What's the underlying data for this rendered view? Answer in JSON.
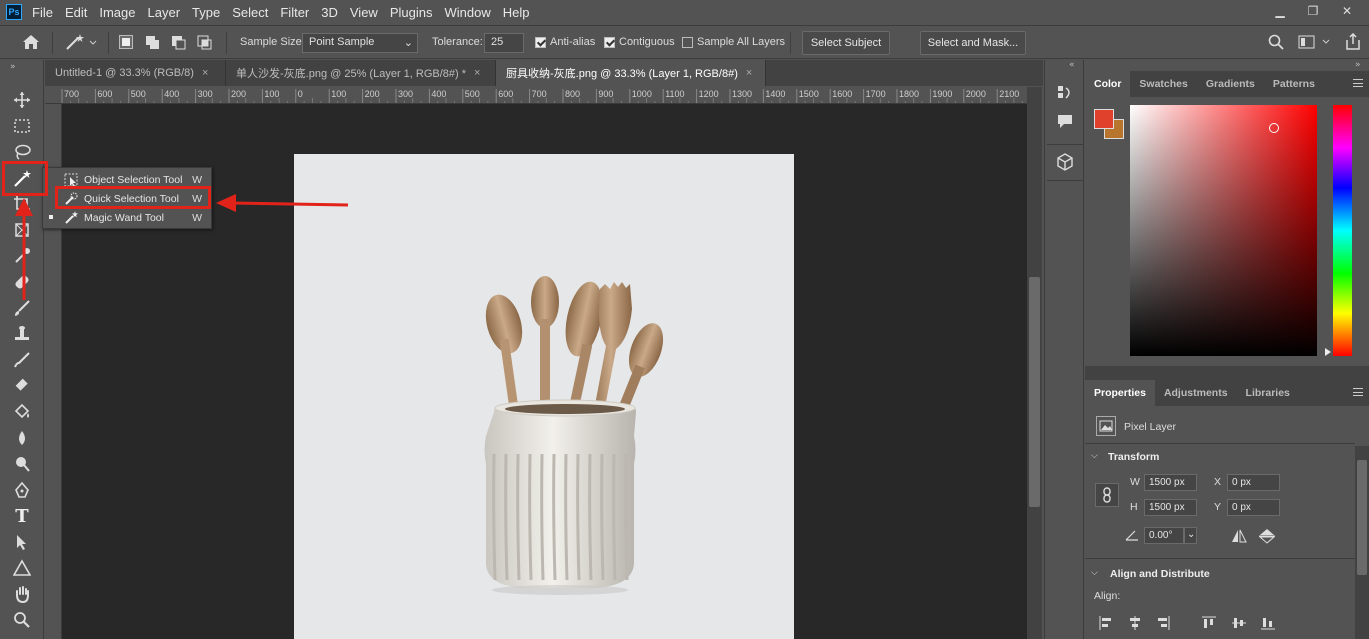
{
  "menubar": {
    "logo": "Ps",
    "items": [
      "File",
      "Edit",
      "Image",
      "Layer",
      "Type",
      "Select",
      "Filter",
      "3D",
      "View",
      "Plugins",
      "Window",
      "Help"
    ],
    "minimize": "▁",
    "restore": "❐",
    "close": "✕"
  },
  "options": {
    "sample_size_label": "Sample Size:",
    "sample_size_value": "Point Sample",
    "tolerance_label": "Tolerance:",
    "tolerance_value": "25",
    "anti_alias_label": "Anti-alias",
    "contiguous_label": "Contiguous",
    "sample_all_layers_label": "Sample All Layers",
    "select_subject_label": "Select Subject",
    "select_and_mask_label": "Select and Mask..."
  },
  "tabs": [
    {
      "label": "Untitled-1 @ 33.3% (RGB/8)",
      "close": "×"
    },
    {
      "label": "单人沙发-灰底.png @ 25% (Layer 1, RGB/8#) *",
      "close": "×"
    },
    {
      "label": "厨具收纳-灰底.png @ 33.3% (Layer 1, RGB/8#)",
      "close": "×"
    }
  ],
  "ruler": {
    "ticks": [
      "700",
      "600",
      "500",
      "400",
      "300",
      "200",
      "100",
      "0",
      "100",
      "200",
      "300",
      "400",
      "500",
      "600",
      "700",
      "800",
      "900",
      "1000",
      "1100",
      "1200",
      "1300",
      "1400",
      "1500",
      "1600",
      "1700",
      "1800",
      "1900",
      "2000",
      "2100"
    ]
  },
  "flyout": {
    "items": [
      {
        "label": "Object Selection Tool",
        "key": "W"
      },
      {
        "label": "Quick Selection Tool",
        "key": "W"
      },
      {
        "label": "Magic Wand Tool",
        "key": "W"
      }
    ]
  },
  "color_panel": {
    "tabs": [
      "Color",
      "Swatches",
      "Gradients",
      "Patterns"
    ],
    "foreground": "#e0412c",
    "background": "#b8752e"
  },
  "properties_panel": {
    "tabs": [
      "Properties",
      "Adjustments",
      "Libraries"
    ],
    "layer_type": "Pixel Layer",
    "transform_title": "Transform",
    "w_label": "W",
    "w_value": "1500 px",
    "h_label": "H",
    "h_value": "1500 px",
    "x_label": "X",
    "x_value": "0 px",
    "y_label": "Y",
    "y_value": "0 px",
    "angle_value": "0.00°",
    "align_title": "Align and Distribute",
    "align_label": "Align:"
  },
  "colors": {
    "highlight": "#e2231a",
    "doc_background": "#e6e7e9"
  }
}
